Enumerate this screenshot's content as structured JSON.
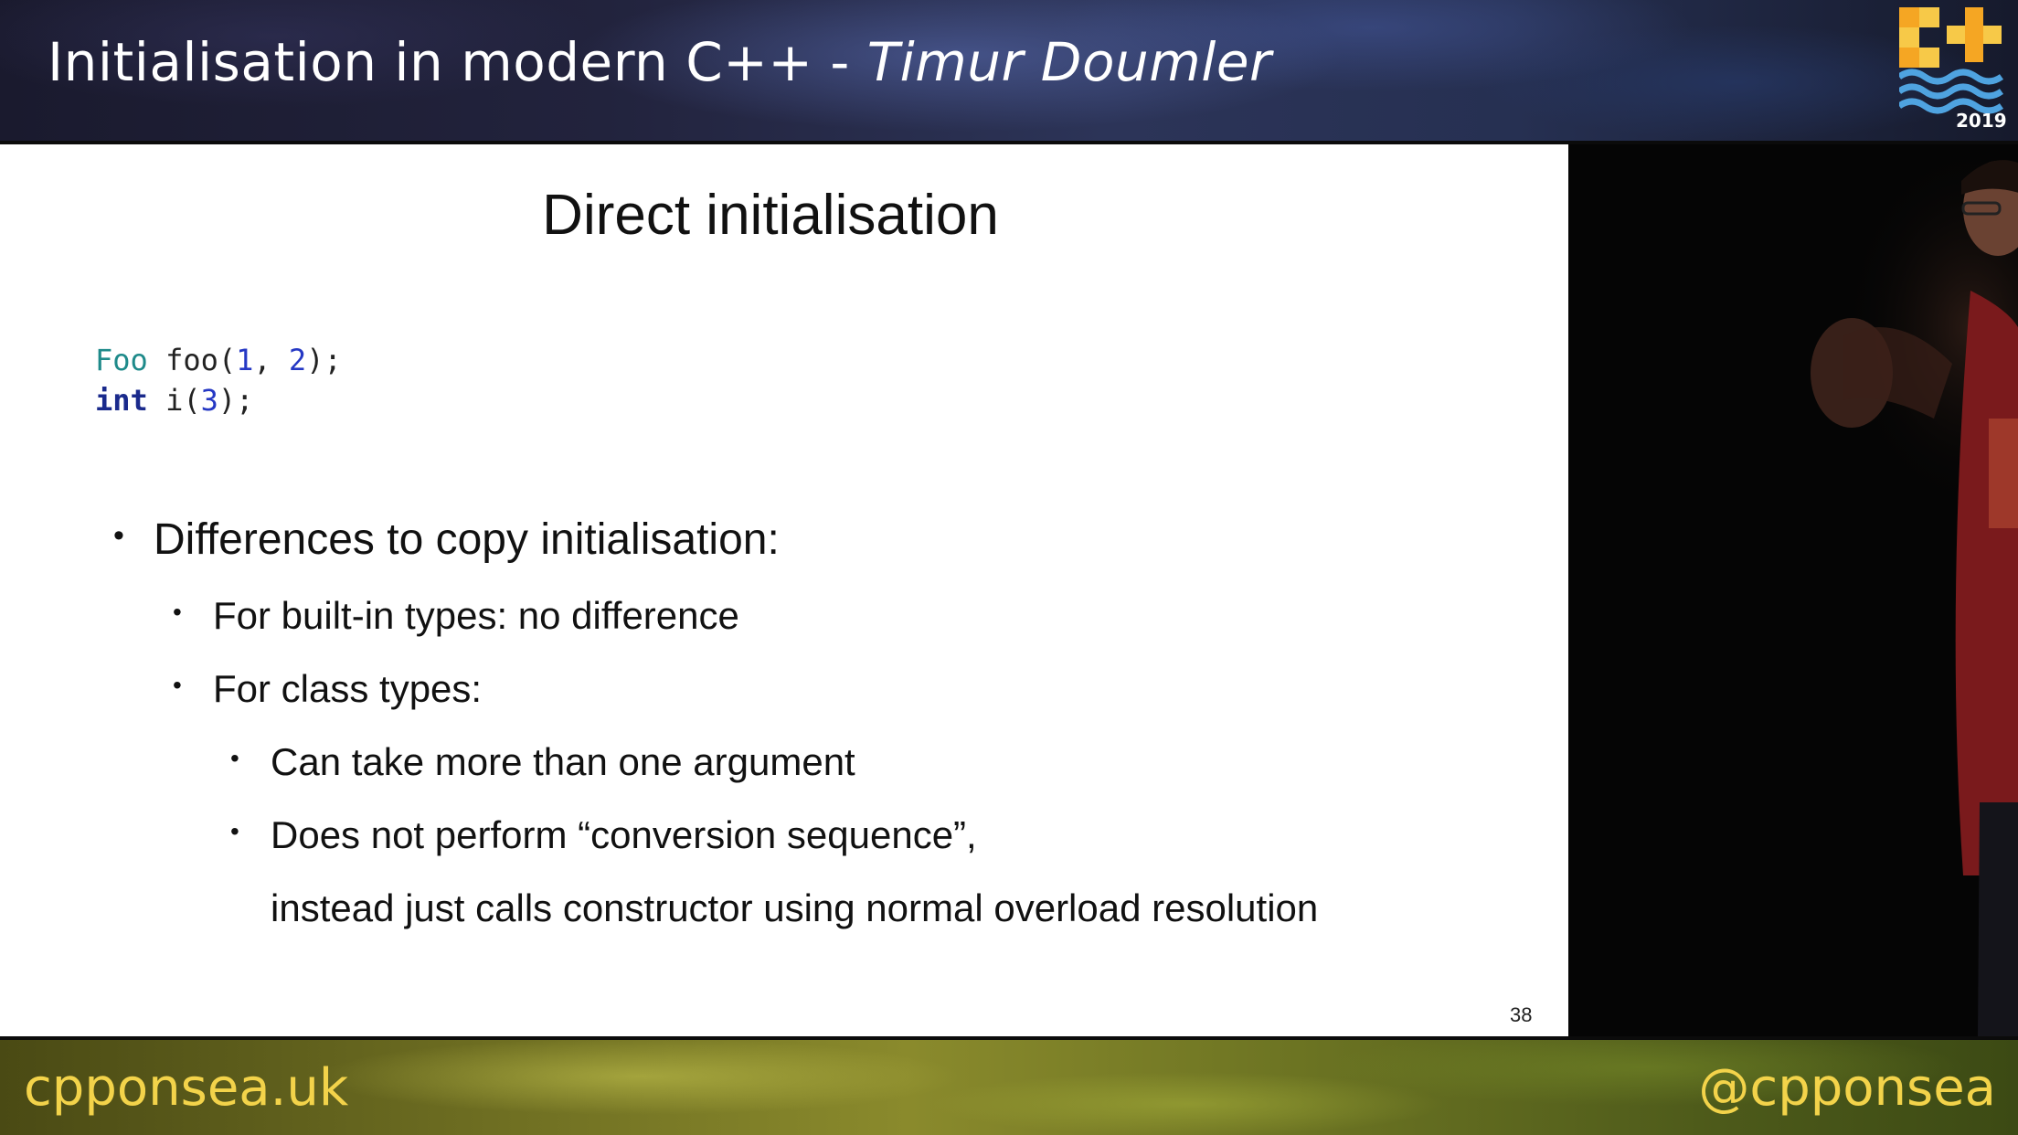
{
  "header": {
    "title": "Initialisation in modern C++ - ",
    "author": "Timur Doumler",
    "logo_year": "2019"
  },
  "slide": {
    "title": "Direct initialisation",
    "code": [
      {
        "type": "Foo",
        "rest1": " foo(",
        "n1": "1",
        "sep": ", ",
        "n2": "2",
        "end": ");"
      },
      {
        "kw": "int",
        "rest1": " i(",
        "n1": "3",
        "end": ");"
      }
    ],
    "bullets": {
      "b1": "Differences to copy initialisation:",
      "b2": "For built-in types: no difference",
      "b3": "For class types:",
      "b4": "Can take more than one argument",
      "b5": "Does not perform “conversion sequence”,",
      "b6": "instead just calls constructor using normal overload resolution"
    },
    "page_number": "38"
  },
  "footer": {
    "website": "cpponsea.uk",
    "handle": "@cpponsea"
  },
  "colors": {
    "accent": "#f3d34a",
    "code_type": "#1e8a8a",
    "code_number": "#2538c4",
    "code_keyword": "#1a2a8c"
  }
}
